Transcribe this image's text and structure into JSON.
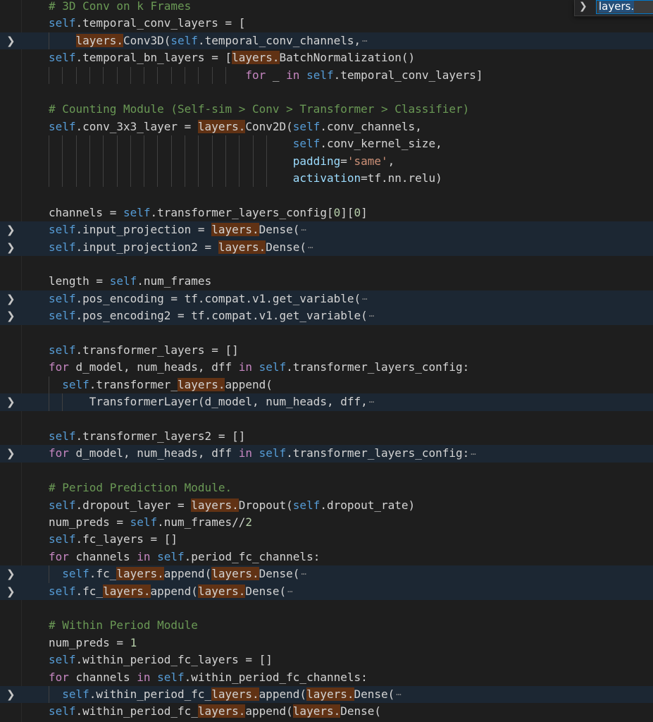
{
  "find_widget": {
    "query": "layers.",
    "toggle_icon": "chevron-right-icon"
  },
  "colors": {
    "background": "#1e1e1e",
    "folded_line_background": "#1c2733",
    "match_highlight": "#613214",
    "comment": "#6a9955",
    "keyword": "#569cd6",
    "control_keyword": "#c586c0",
    "variable": "#9cdcfe",
    "function": "#dcdcaa",
    "string": "#ce9178",
    "number": "#b5cea8"
  },
  "lines": [
    {
      "folded": false,
      "guides": 0,
      "tokens": [
        [
          "cm",
          "# 3D Conv on k Frames"
        ]
      ]
    },
    {
      "folded": false,
      "guides": 0,
      "tokens": [
        [
          "kw",
          "self"
        ],
        [
          "pl",
          ".temporal_conv_layers = ["
        ]
      ]
    },
    {
      "folded": true,
      "guides": 1,
      "ellipsis": true,
      "tokens": [
        [
          "pl",
          "    "
        ],
        [
          "hl",
          "layers."
        ],
        [
          "pl",
          "Conv3D("
        ],
        [
          "kw",
          "self"
        ],
        [
          "pl",
          ".temporal_conv_channels,"
        ]
      ]
    },
    {
      "folded": false,
      "guides": 0,
      "tokens": [
        [
          "kw",
          "self"
        ],
        [
          "pl",
          ".temporal_bn_layers = ["
        ],
        [
          "hl",
          "layers."
        ],
        [
          "pl",
          "BatchNormalization()"
        ]
      ]
    },
    {
      "folded": false,
      "guides": 14,
      "tokens": [
        [
          "pl",
          "                             "
        ],
        [
          "ct",
          "for"
        ],
        [
          "pl",
          " _ "
        ],
        [
          "ct",
          "in"
        ],
        [
          "pl",
          " "
        ],
        [
          "kw",
          "self"
        ],
        [
          "pl",
          ".temporal_conv_layers]"
        ]
      ]
    },
    {
      "folded": false,
      "guides": 0,
      "tokens": [
        [
          "pl",
          ""
        ]
      ]
    },
    {
      "folded": false,
      "guides": 0,
      "tokens": [
        [
          "cm",
          "# Counting Module (Self-sim > Conv > Transformer > Classifier)"
        ]
      ]
    },
    {
      "folded": false,
      "guides": 0,
      "tokens": [
        [
          "kw",
          "self"
        ],
        [
          "pl",
          ".conv_3x3_layer = "
        ],
        [
          "hl",
          "layers."
        ],
        [
          "pl",
          "Conv2D("
        ],
        [
          "kw",
          "self"
        ],
        [
          "pl",
          ".conv_channels,"
        ]
      ]
    },
    {
      "folded": false,
      "guides": 17,
      "tokens": [
        [
          "pl",
          "                                    "
        ],
        [
          "kw",
          "self"
        ],
        [
          "pl",
          ".conv_kernel_size,"
        ]
      ]
    },
    {
      "folded": false,
      "guides": 17,
      "tokens": [
        [
          "pl",
          "                                    "
        ],
        [
          "vr",
          "padding"
        ],
        [
          "pl",
          "="
        ],
        [
          "st",
          "'same'"
        ],
        [
          "pl",
          ","
        ]
      ]
    },
    {
      "folded": false,
      "guides": 17,
      "tokens": [
        [
          "pl",
          "                                    "
        ],
        [
          "vr",
          "activation"
        ],
        [
          "pl",
          "=tf.nn.relu)"
        ]
      ]
    },
    {
      "folded": false,
      "guides": 0,
      "tokens": [
        [
          "pl",
          ""
        ]
      ]
    },
    {
      "folded": false,
      "guides": 0,
      "tokens": [
        [
          "pl",
          "channels = "
        ],
        [
          "kw",
          "self"
        ],
        [
          "pl",
          ".transformer_layers_config["
        ],
        [
          "nm",
          "0"
        ],
        [
          "pl",
          "]["
        ],
        [
          "nm",
          "0"
        ],
        [
          "pl",
          "]"
        ]
      ]
    },
    {
      "folded": true,
      "guides": 0,
      "ellipsis": true,
      "tokens": [
        [
          "kw",
          "self"
        ],
        [
          "pl",
          ".input_projection = "
        ],
        [
          "hl",
          "layers."
        ],
        [
          "pl",
          "Dense("
        ]
      ]
    },
    {
      "folded": true,
      "guides": 0,
      "ellipsis": true,
      "tokens": [
        [
          "kw",
          "self"
        ],
        [
          "pl",
          ".input_projection2 = "
        ],
        [
          "hl",
          "layers."
        ],
        [
          "pl",
          "Dense("
        ]
      ]
    },
    {
      "folded": false,
      "guides": 0,
      "tokens": [
        [
          "pl",
          ""
        ]
      ]
    },
    {
      "folded": false,
      "guides": 0,
      "tokens": [
        [
          "pl",
          "length = "
        ],
        [
          "kw",
          "self"
        ],
        [
          "pl",
          ".num_frames"
        ]
      ]
    },
    {
      "folded": true,
      "guides": 0,
      "ellipsis": true,
      "tokens": [
        [
          "kw",
          "self"
        ],
        [
          "pl",
          ".pos_encoding = tf.compat.v1.get_variable("
        ]
      ]
    },
    {
      "folded": true,
      "guides": 0,
      "ellipsis": true,
      "tokens": [
        [
          "kw",
          "self"
        ],
        [
          "pl",
          ".pos_encoding2 = tf.compat.v1.get_variable("
        ]
      ]
    },
    {
      "folded": false,
      "guides": 0,
      "tokens": [
        [
          "pl",
          ""
        ]
      ]
    },
    {
      "folded": false,
      "guides": 0,
      "tokens": [
        [
          "kw",
          "self"
        ],
        [
          "pl",
          ".transformer_layers = []"
        ]
      ]
    },
    {
      "folded": false,
      "guides": 0,
      "tokens": [
        [
          "ct",
          "for"
        ],
        [
          "pl",
          " d_model, num_heads, dff "
        ],
        [
          "ct",
          "in"
        ],
        [
          "pl",
          " "
        ],
        [
          "kw",
          "self"
        ],
        [
          "pl",
          ".transformer_layers_config:"
        ]
      ]
    },
    {
      "folded": false,
      "guides": 1,
      "tokens": [
        [
          "pl",
          "  "
        ],
        [
          "kw",
          "self"
        ],
        [
          "pl",
          ".transformer_"
        ],
        [
          "hl",
          "layers."
        ],
        [
          "pl",
          "append("
        ]
      ]
    },
    {
      "folded": true,
      "guides": 2,
      "ellipsis": true,
      "tokens": [
        [
          "pl",
          "      TransformerLayer(d_model, num_heads, dff,"
        ]
      ]
    },
    {
      "folded": false,
      "guides": 0,
      "tokens": [
        [
          "pl",
          ""
        ]
      ]
    },
    {
      "folded": false,
      "guides": 0,
      "tokens": [
        [
          "kw",
          "self"
        ],
        [
          "pl",
          ".transformer_layers2 = []"
        ]
      ]
    },
    {
      "folded": true,
      "guides": 0,
      "ellipsis": true,
      "tokens": [
        [
          "ct",
          "for"
        ],
        [
          "pl",
          " d_model, num_heads, dff "
        ],
        [
          "ct",
          "in"
        ],
        [
          "pl",
          " "
        ],
        [
          "kw",
          "self"
        ],
        [
          "pl",
          ".transformer_layers_config:"
        ]
      ]
    },
    {
      "folded": false,
      "guides": 0,
      "tokens": [
        [
          "pl",
          ""
        ]
      ]
    },
    {
      "folded": false,
      "guides": 0,
      "tokens": [
        [
          "cm",
          "# Period Prediction Module."
        ]
      ]
    },
    {
      "folded": false,
      "guides": 0,
      "tokens": [
        [
          "kw",
          "self"
        ],
        [
          "pl",
          ".dropout_layer = "
        ],
        [
          "hl",
          "layers."
        ],
        [
          "pl",
          "Dropout("
        ],
        [
          "kw",
          "self"
        ],
        [
          "pl",
          ".dropout_rate)"
        ]
      ]
    },
    {
      "folded": false,
      "guides": 0,
      "tokens": [
        [
          "pl",
          "num_preds = "
        ],
        [
          "kw",
          "self"
        ],
        [
          "pl",
          ".num_frames//"
        ],
        [
          "nm",
          "2"
        ]
      ]
    },
    {
      "folded": false,
      "guides": 0,
      "tokens": [
        [
          "kw",
          "self"
        ],
        [
          "pl",
          ".fc_layers = []"
        ]
      ]
    },
    {
      "folded": false,
      "guides": 0,
      "tokens": [
        [
          "ct",
          "for"
        ],
        [
          "pl",
          " channels "
        ],
        [
          "ct",
          "in"
        ],
        [
          "pl",
          " "
        ],
        [
          "kw",
          "self"
        ],
        [
          "pl",
          ".period_fc_channels:"
        ]
      ]
    },
    {
      "folded": true,
      "guides": 1,
      "ellipsis": true,
      "tokens": [
        [
          "pl",
          "  "
        ],
        [
          "kw",
          "self"
        ],
        [
          "pl",
          ".fc_"
        ],
        [
          "hl",
          "layers."
        ],
        [
          "pl",
          "append("
        ],
        [
          "hl",
          "layers."
        ],
        [
          "pl",
          "Dense("
        ]
      ]
    },
    {
      "folded": true,
      "guides": 0,
      "ellipsis": true,
      "tokens": [
        [
          "kw",
          "self"
        ],
        [
          "pl",
          ".fc_"
        ],
        [
          "hl",
          "layers."
        ],
        [
          "pl",
          "append("
        ],
        [
          "hl",
          "layers."
        ],
        [
          "pl",
          "Dense("
        ]
      ]
    },
    {
      "folded": false,
      "guides": 0,
      "tokens": [
        [
          "pl",
          ""
        ]
      ]
    },
    {
      "folded": false,
      "guides": 0,
      "tokens": [
        [
          "cm",
          "# Within Period Module"
        ]
      ]
    },
    {
      "folded": false,
      "guides": 0,
      "tokens": [
        [
          "pl",
          "num_preds = "
        ],
        [
          "nm",
          "1"
        ]
      ]
    },
    {
      "folded": false,
      "guides": 0,
      "tokens": [
        [
          "kw",
          "self"
        ],
        [
          "pl",
          ".within_period_fc_layers = []"
        ]
      ]
    },
    {
      "folded": false,
      "guides": 0,
      "tokens": [
        [
          "ct",
          "for"
        ],
        [
          "pl",
          " channels "
        ],
        [
          "ct",
          "in"
        ],
        [
          "pl",
          " "
        ],
        [
          "kw",
          "self"
        ],
        [
          "pl",
          ".within_period_fc_channels:"
        ]
      ]
    },
    {
      "folded": true,
      "guides": 1,
      "ellipsis": true,
      "tokens": [
        [
          "pl",
          "  "
        ],
        [
          "kw",
          "self"
        ],
        [
          "pl",
          ".within_period_fc_"
        ],
        [
          "hl",
          "layers."
        ],
        [
          "pl",
          "append("
        ],
        [
          "hl",
          "layers."
        ],
        [
          "pl",
          "Dense("
        ]
      ]
    },
    {
      "folded": false,
      "guides": 0,
      "tokens": [
        [
          "kw",
          "self"
        ],
        [
          "pl",
          ".within_period_fc_"
        ],
        [
          "hl",
          "layers."
        ],
        [
          "pl",
          "append("
        ],
        [
          "hl",
          "layers."
        ],
        [
          "pl",
          "Dense("
        ]
      ]
    }
  ]
}
